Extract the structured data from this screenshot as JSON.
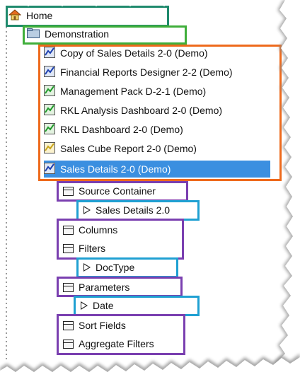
{
  "tree": {
    "root": {
      "label": "Home",
      "icon": "home-icon"
    },
    "folder": {
      "label": "Demonstration",
      "icon": "folder-icon"
    },
    "reports": [
      {
        "label": "Copy of Sales Details 2-0 (Demo)",
        "icon": "report-blue-icon"
      },
      {
        "label": "Financial Reports Designer 2-2 (Demo)",
        "icon": "report-blue-icon"
      },
      {
        "label": "Management Pack D-2-1 (Demo)",
        "icon": "report-green-icon"
      },
      {
        "label": "RKL Analysis Dashboard 2-0 (Demo)",
        "icon": "report-green-icon"
      },
      {
        "label": "RKL Dashboard 2-0 (Demo)",
        "icon": "report-green-icon"
      },
      {
        "label": "Sales Cube Report 2-0 (Demo)",
        "icon": "report-yellow-icon"
      },
      {
        "label": "Sales Details 2-0 (Demo)",
        "icon": "report-blue-icon",
        "selected": true
      }
    ],
    "children": {
      "source_container": "Source Container",
      "sales_details": "Sales Details 2.0",
      "columns": "Columns",
      "filters": "Filters",
      "doctype": "DocType",
      "parameters": "Parameters",
      "date": "Date",
      "sort_fields": "Sort Fields",
      "aggregate_filters": "Aggregate Filters"
    }
  },
  "colors": {
    "teal_box": "#1f8a6d",
    "green_box": "#3fae3a",
    "orange_box": "#ee6a1c",
    "purple_box": "#7a3fb0",
    "blue_box": "#1fa0d2",
    "selection": "#3b8fe0"
  }
}
